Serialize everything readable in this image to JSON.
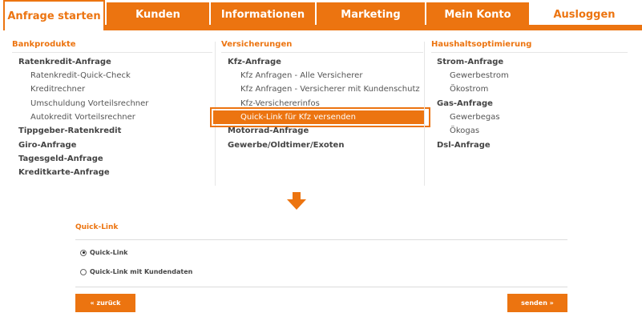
{
  "nav": {
    "tabs": [
      {
        "label": "Anfrage starten"
      },
      {
        "label": "Kunden"
      },
      {
        "label": "Informationen"
      },
      {
        "label": "Marketing"
      },
      {
        "label": "Mein Konto"
      },
      {
        "label": "Ausloggen"
      }
    ]
  },
  "menu": {
    "bankprodukte": {
      "heading": "Bankprodukte",
      "items": [
        "Ratenkredit-Anfrage",
        "Ratenkredit-Quick-Check",
        "Kreditrechner",
        "Umschuldung Vorteilsrechner",
        "Autokredit Vorteilsrechner",
        "Tippgeber-Ratenkredit",
        "Giro-Anfrage",
        "Tagesgeld-Anfrage",
        "Kreditkarte-Anfrage"
      ]
    },
    "versicherungen": {
      "heading": "Versicherungen",
      "items": [
        "Kfz-Anfrage",
        "Kfz Anfragen - Alle Versicherer",
        "Kfz Anfragen - Versicherer mit Kundenschutz",
        "Kfz-Versichererinfos",
        "Quick-Link für Kfz versenden",
        "Motorrad-Anfrage",
        "Gewerbe/Oldtimer/Exoten"
      ]
    },
    "haushalt": {
      "heading": "Haushaltsoptimierung",
      "items": [
        "Strom-Anfrage",
        "Gewerbestrom",
        "Ökostrom",
        "Gas-Anfrage",
        "Gewerbegas",
        "Ökogas",
        "Dsl-Anfrage"
      ]
    }
  },
  "quicklink": {
    "title": "Quick-Link",
    "options": [
      "Quick-Link",
      "Quick-Link mit Kundendaten"
    ],
    "selected": "Quick-Link",
    "back_label": "« zurück",
    "send_label": "senden »"
  },
  "colors": {
    "accent": "#ec7410"
  }
}
